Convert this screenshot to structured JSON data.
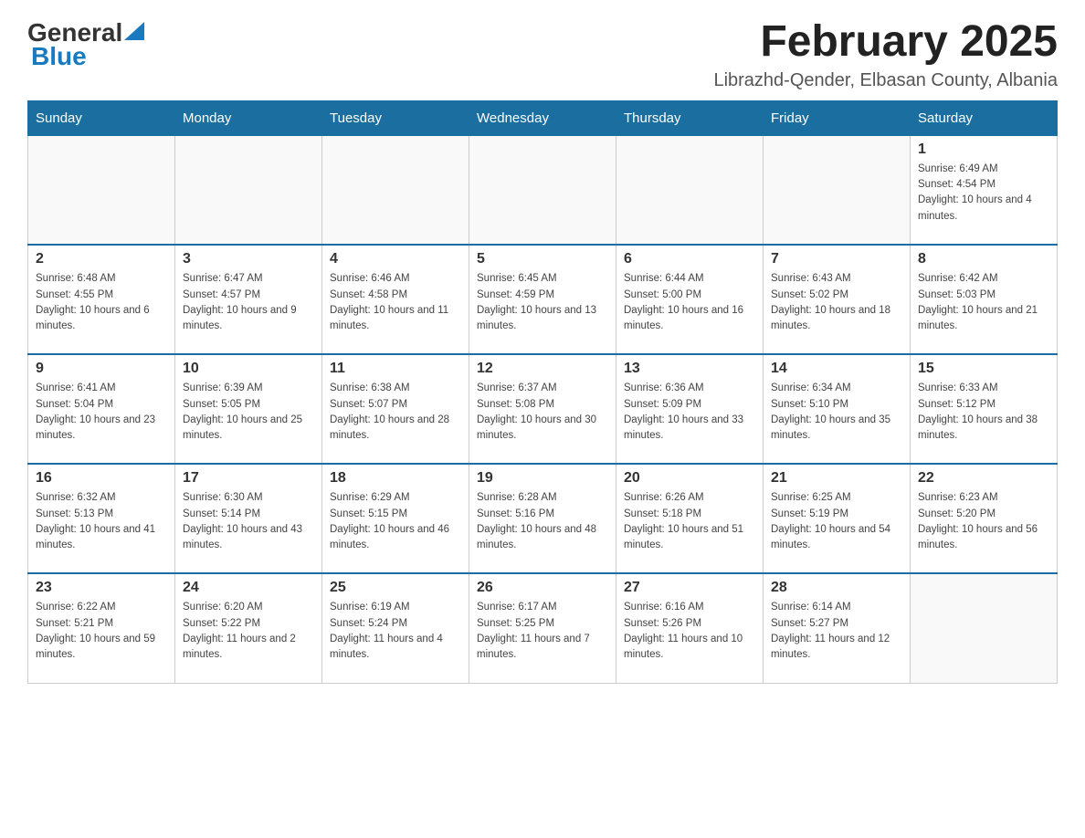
{
  "header": {
    "logo": {
      "general": "General",
      "blue": "Blue",
      "tagline": ""
    },
    "title": "February 2025",
    "subtitle": "Librazhd-Qender, Elbasan County, Albania"
  },
  "days_of_week": [
    "Sunday",
    "Monday",
    "Tuesday",
    "Wednesday",
    "Thursday",
    "Friday",
    "Saturday"
  ],
  "weeks": [
    [
      {
        "day": "",
        "info": ""
      },
      {
        "day": "",
        "info": ""
      },
      {
        "day": "",
        "info": ""
      },
      {
        "day": "",
        "info": ""
      },
      {
        "day": "",
        "info": ""
      },
      {
        "day": "",
        "info": ""
      },
      {
        "day": "1",
        "info": "Sunrise: 6:49 AM\nSunset: 4:54 PM\nDaylight: 10 hours and 4 minutes."
      }
    ],
    [
      {
        "day": "2",
        "info": "Sunrise: 6:48 AM\nSunset: 4:55 PM\nDaylight: 10 hours and 6 minutes."
      },
      {
        "day": "3",
        "info": "Sunrise: 6:47 AM\nSunset: 4:57 PM\nDaylight: 10 hours and 9 minutes."
      },
      {
        "day": "4",
        "info": "Sunrise: 6:46 AM\nSunset: 4:58 PM\nDaylight: 10 hours and 11 minutes."
      },
      {
        "day": "5",
        "info": "Sunrise: 6:45 AM\nSunset: 4:59 PM\nDaylight: 10 hours and 13 minutes."
      },
      {
        "day": "6",
        "info": "Sunrise: 6:44 AM\nSunset: 5:00 PM\nDaylight: 10 hours and 16 minutes."
      },
      {
        "day": "7",
        "info": "Sunrise: 6:43 AM\nSunset: 5:02 PM\nDaylight: 10 hours and 18 minutes."
      },
      {
        "day": "8",
        "info": "Sunrise: 6:42 AM\nSunset: 5:03 PM\nDaylight: 10 hours and 21 minutes."
      }
    ],
    [
      {
        "day": "9",
        "info": "Sunrise: 6:41 AM\nSunset: 5:04 PM\nDaylight: 10 hours and 23 minutes."
      },
      {
        "day": "10",
        "info": "Sunrise: 6:39 AM\nSunset: 5:05 PM\nDaylight: 10 hours and 25 minutes."
      },
      {
        "day": "11",
        "info": "Sunrise: 6:38 AM\nSunset: 5:07 PM\nDaylight: 10 hours and 28 minutes."
      },
      {
        "day": "12",
        "info": "Sunrise: 6:37 AM\nSunset: 5:08 PM\nDaylight: 10 hours and 30 minutes."
      },
      {
        "day": "13",
        "info": "Sunrise: 6:36 AM\nSunset: 5:09 PM\nDaylight: 10 hours and 33 minutes."
      },
      {
        "day": "14",
        "info": "Sunrise: 6:34 AM\nSunset: 5:10 PM\nDaylight: 10 hours and 35 minutes."
      },
      {
        "day": "15",
        "info": "Sunrise: 6:33 AM\nSunset: 5:12 PM\nDaylight: 10 hours and 38 minutes."
      }
    ],
    [
      {
        "day": "16",
        "info": "Sunrise: 6:32 AM\nSunset: 5:13 PM\nDaylight: 10 hours and 41 minutes."
      },
      {
        "day": "17",
        "info": "Sunrise: 6:30 AM\nSunset: 5:14 PM\nDaylight: 10 hours and 43 minutes."
      },
      {
        "day": "18",
        "info": "Sunrise: 6:29 AM\nSunset: 5:15 PM\nDaylight: 10 hours and 46 minutes."
      },
      {
        "day": "19",
        "info": "Sunrise: 6:28 AM\nSunset: 5:16 PM\nDaylight: 10 hours and 48 minutes."
      },
      {
        "day": "20",
        "info": "Sunrise: 6:26 AM\nSunset: 5:18 PM\nDaylight: 10 hours and 51 minutes."
      },
      {
        "day": "21",
        "info": "Sunrise: 6:25 AM\nSunset: 5:19 PM\nDaylight: 10 hours and 54 minutes."
      },
      {
        "day": "22",
        "info": "Sunrise: 6:23 AM\nSunset: 5:20 PM\nDaylight: 10 hours and 56 minutes."
      }
    ],
    [
      {
        "day": "23",
        "info": "Sunrise: 6:22 AM\nSunset: 5:21 PM\nDaylight: 10 hours and 59 minutes."
      },
      {
        "day": "24",
        "info": "Sunrise: 6:20 AM\nSunset: 5:22 PM\nDaylight: 11 hours and 2 minutes."
      },
      {
        "day": "25",
        "info": "Sunrise: 6:19 AM\nSunset: 5:24 PM\nDaylight: 11 hours and 4 minutes."
      },
      {
        "day": "26",
        "info": "Sunrise: 6:17 AM\nSunset: 5:25 PM\nDaylight: 11 hours and 7 minutes."
      },
      {
        "day": "27",
        "info": "Sunrise: 6:16 AM\nSunset: 5:26 PM\nDaylight: 11 hours and 10 minutes."
      },
      {
        "day": "28",
        "info": "Sunrise: 6:14 AM\nSunset: 5:27 PM\nDaylight: 11 hours and 12 minutes."
      },
      {
        "day": "",
        "info": ""
      }
    ]
  ]
}
